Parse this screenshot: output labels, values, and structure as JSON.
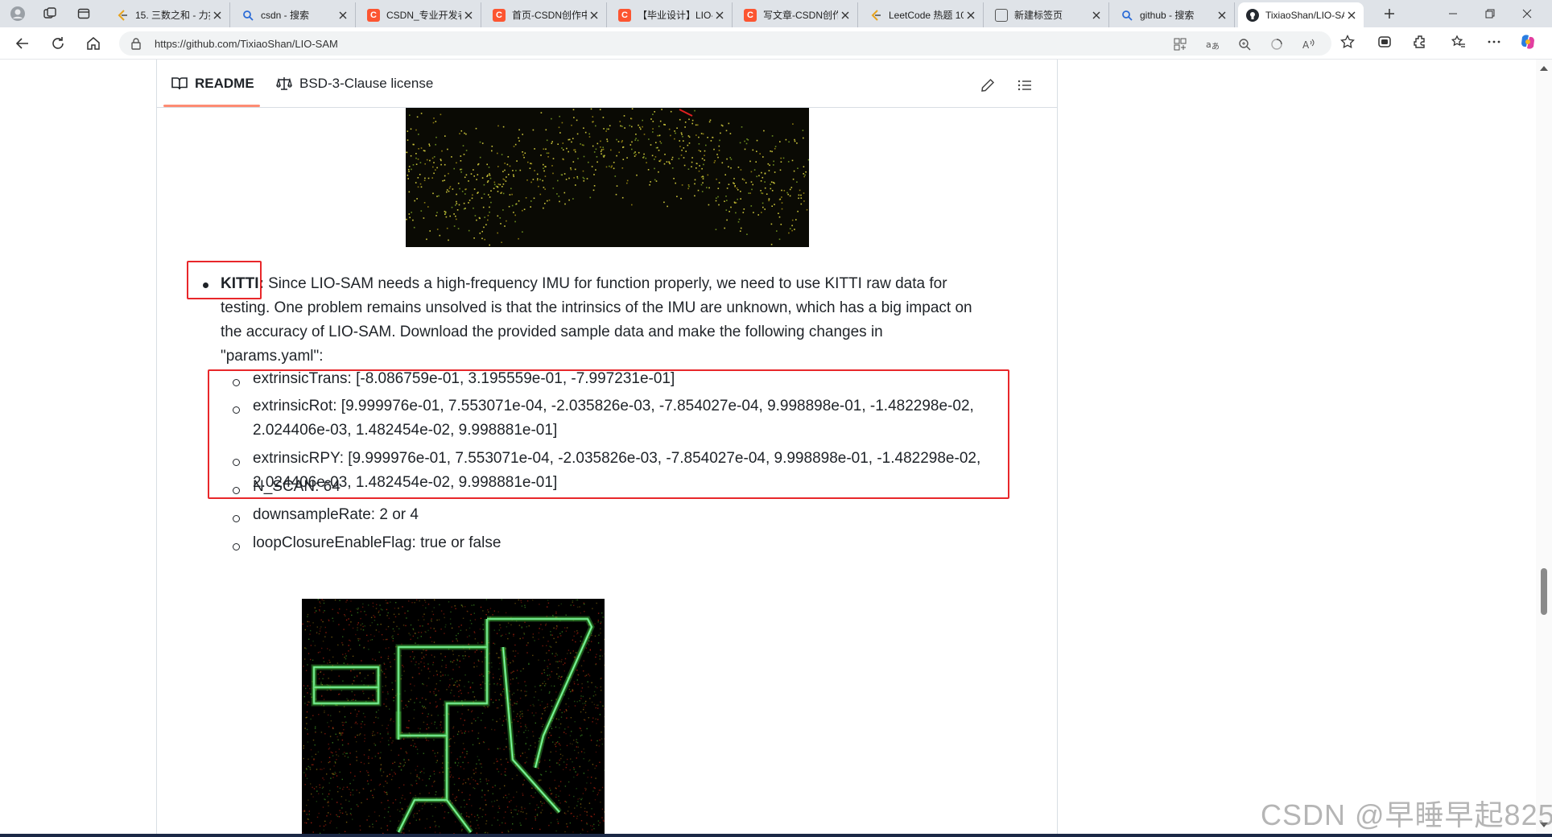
{
  "browser": {
    "tabs": [
      {
        "title": "15. 三数之和 - 力扣",
        "favicon": "leetcode-icon"
      },
      {
        "title": "csdn - 搜索",
        "favicon": "search-icon"
      },
      {
        "title": "CSDN_专业开发者",
        "favicon": "csdn-icon"
      },
      {
        "title": "首页-CSDN创作中",
        "favicon": "csdn-icon"
      },
      {
        "title": "【毕业设计】LIO-",
        "favicon": "csdn-icon"
      },
      {
        "title": "写文章-CSDN创作",
        "favicon": "csdn-icon"
      },
      {
        "title": "LeetCode 热题 10",
        "favicon": "leetcode-icon"
      },
      {
        "title": "新建标签页",
        "favicon": "newtab-icon"
      },
      {
        "title": "github - 搜索",
        "favicon": "search-icon"
      },
      {
        "title": "TixiaoShan/LIO-SA",
        "favicon": "github-icon",
        "active": true
      }
    ],
    "url": "https://github.com/TixiaoShan/LIO-SAM"
  },
  "readme": {
    "tabs": [
      {
        "label": "README",
        "active": true
      },
      {
        "label": "BSD-3-Clause license"
      }
    ],
    "kitti": {
      "label": "KITTI:",
      "lines": [
        "Since LIO-SAM needs a high-frequency IMU for function properly, we need to use KITTI raw data for",
        "testing. One problem remains unsolved is that the intrinsics of the IMU are unknown, which has a big impact on",
        "the accuracy of LIO-SAM. Download the provided sample data and make the following changes in",
        "\"params.yaml\":"
      ]
    },
    "params": [
      {
        "lines": [
          "extrinsicTrans: [-8.086759e-01, 3.195559e-01, -7.997231e-01]"
        ]
      },
      {
        "lines": [
          "extrinsicRot: [9.999976e-01, 7.553071e-04, -2.035826e-03, -7.854027e-04, 9.998898e-01, -1.482298e-02,",
          "2.024406e-03, 1.482454e-02, 9.998881e-01]"
        ]
      },
      {
        "lines": [
          "extrinsicRPY: [9.999976e-01, 7.553071e-04, -2.035826e-03, -7.854027e-04, 9.998898e-01, -1.482298e-02,",
          "2.024406e-03, 1.482454e-02, 9.998881e-01]"
        ]
      },
      {
        "lines": [
          "N_SCAN: 64"
        ]
      },
      {
        "lines": [
          "downsampleRate: 2 or 4"
        ]
      },
      {
        "lines": [
          "loopClosureEnableFlag: true or false"
        ]
      }
    ]
  },
  "watermark": "CSDN @早睡早起825",
  "colors": {
    "annotation_red": "#e8272a",
    "tab_underline": "#fd8c73",
    "csdn_red": "#fc5531",
    "map_green": "#4cd14a",
    "map_yellow": "#c9c23a"
  }
}
